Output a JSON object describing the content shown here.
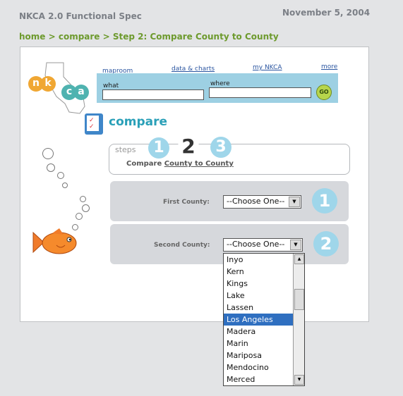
{
  "doc_header": {
    "title": "NKCA 2.0 Functional Spec",
    "date": "November 5, 2004"
  },
  "breadcrumb": "home > compare > Step 2: Compare County to County",
  "logo": {
    "letters": [
      "n",
      "k",
      "c",
      "a"
    ]
  },
  "nav": {
    "links": [
      "maproom",
      "data & charts",
      "my NKCA",
      "more"
    ]
  },
  "search": {
    "what_label": "what",
    "where_label": "where",
    "go_label": "GO"
  },
  "compare": {
    "title": "compare"
  },
  "steps": {
    "label": "steps",
    "numbers": [
      "1",
      "2",
      "3"
    ],
    "current_prefix": "Compare ",
    "current_link": "County to County"
  },
  "first_county": {
    "label": "First County:",
    "value": "--Choose One--",
    "step": "1"
  },
  "second_county": {
    "label": "Second County:",
    "value": "--Choose One--",
    "step": "2"
  },
  "dropdown_options": [
    "Inyo",
    "Kern",
    "Kings",
    "Lake",
    "Lassen",
    "Los Angeles",
    "Madera",
    "Marin",
    "Mariposa",
    "Mendocino",
    "Merced"
  ],
  "selected_option": "Los Angeles",
  "colors": {
    "accent_teal": "#2aa0b8",
    "green": "#6d9a2d",
    "step_blue": "#9fd6ea",
    "logo_orange": "#f0a733",
    "logo_teal": "#4fb3b0"
  }
}
